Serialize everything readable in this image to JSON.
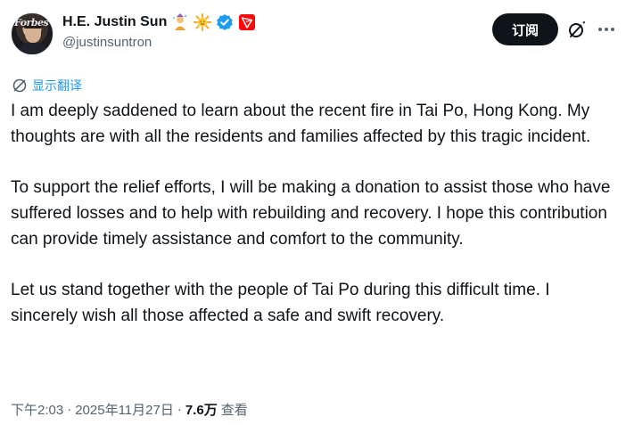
{
  "user": {
    "display_name": "H.E. Justin Sun",
    "handle": "@justinsuntron",
    "avatar_magazine_text": "Forbes",
    "badges": [
      "mage-emoji-icon",
      "sun-emoji-icon",
      "verified-icon",
      "tron-logo-icon"
    ],
    "verified_color": "#1d9bf0",
    "tron_color": "#ff060a"
  },
  "actions": {
    "subscribe_label": "订阅"
  },
  "translate": {
    "label": "显示翻译"
  },
  "tweet": {
    "paragraphs": [
      "I am deeply saddened to learn about the recent fire in Tai Po, Hong Kong. My thoughts are with all the residents and families affected by this tragic incident.",
      "To support the relief efforts, I will be making a donation to assist those who have suffered losses and to help with rebuilding and recovery. I hope this contribution can provide timely assistance and comfort to the community.",
      "Let us stand together with the people of Tai Po during this difficult time. I sincerely wish all those affected a safe and swift recovery."
    ]
  },
  "meta": {
    "time": "下午2:03",
    "separator": "·",
    "date": "2025年11月27日",
    "views": "7.6万",
    "views_label": "查看"
  },
  "colors": {
    "accent": "#1d9bf0",
    "text": "#0f1419",
    "secondary": "#536471"
  }
}
